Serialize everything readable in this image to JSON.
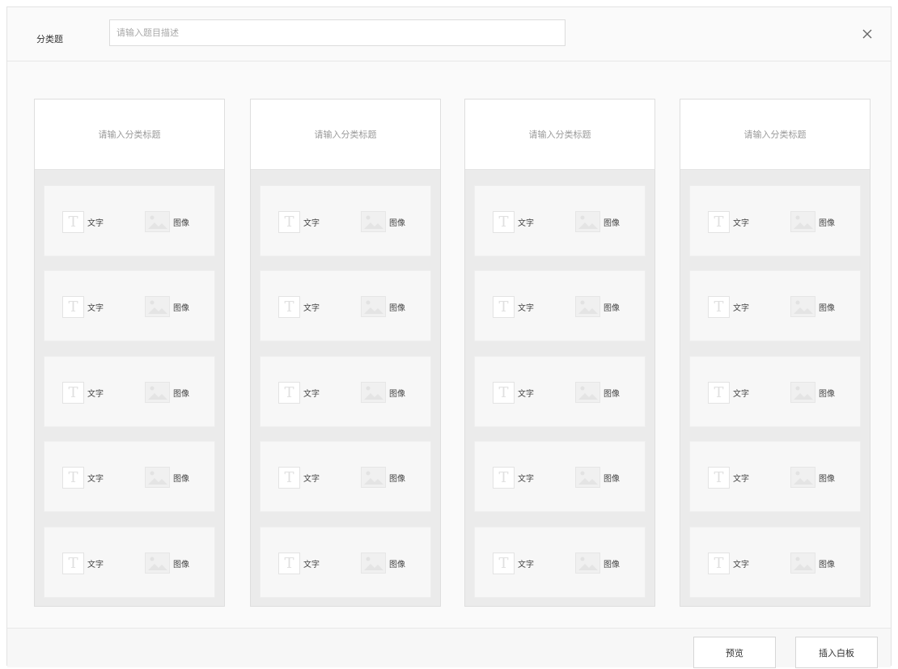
{
  "header": {
    "label": "分类题",
    "title_placeholder": "请输入题目描述",
    "title_value": ""
  },
  "columns": [
    {
      "title_placeholder": "请输入分类标题",
      "slots": [
        {
          "text_label": "文字",
          "image_label": "图像"
        },
        {
          "text_label": "文字",
          "image_label": "图像"
        },
        {
          "text_label": "文字",
          "image_label": "图像"
        },
        {
          "text_label": "文字",
          "image_label": "图像"
        },
        {
          "text_label": "文字",
          "image_label": "图像"
        }
      ]
    },
    {
      "title_placeholder": "请输入分类标题",
      "slots": [
        {
          "text_label": "文字",
          "image_label": "图像"
        },
        {
          "text_label": "文字",
          "image_label": "图像"
        },
        {
          "text_label": "文字",
          "image_label": "图像"
        },
        {
          "text_label": "文字",
          "image_label": "图像"
        },
        {
          "text_label": "文字",
          "image_label": "图像"
        }
      ]
    },
    {
      "title_placeholder": "请输入分类标题",
      "slots": [
        {
          "text_label": "文字",
          "image_label": "图像"
        },
        {
          "text_label": "文字",
          "image_label": "图像"
        },
        {
          "text_label": "文字",
          "image_label": "图像"
        },
        {
          "text_label": "文字",
          "image_label": "图像"
        },
        {
          "text_label": "文字",
          "image_label": "图像"
        }
      ]
    },
    {
      "title_placeholder": "请输入分类标题",
      "slots": [
        {
          "text_label": "文字",
          "image_label": "图像"
        },
        {
          "text_label": "文字",
          "image_label": "图像"
        },
        {
          "text_label": "文字",
          "image_label": "图像"
        },
        {
          "text_label": "文字",
          "image_label": "图像"
        },
        {
          "text_label": "文字",
          "image_label": "图像"
        }
      ]
    }
  ],
  "footer": {
    "preview_label": "预览",
    "insert_label": "插入白板"
  },
  "icons": {
    "close": "close-icon",
    "text": "text-icon",
    "image": "image-icon"
  },
  "colors": {
    "border": "#dedede",
    "column_bg": "#ebebeb",
    "placeholder": "#9a9a9a"
  }
}
